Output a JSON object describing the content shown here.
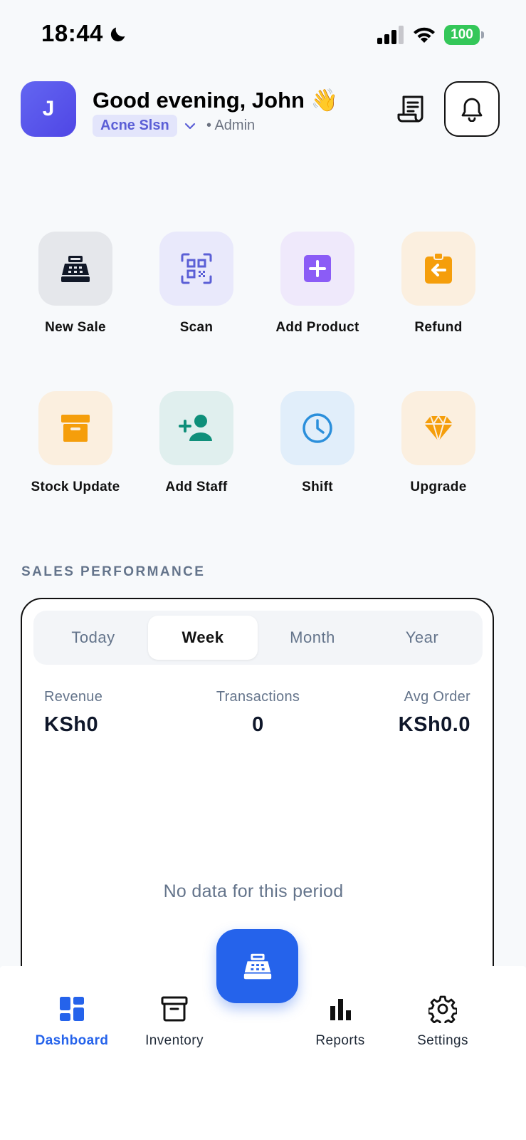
{
  "status_bar": {
    "time": "18:44",
    "battery": "100",
    "icons": [
      "moon-icon",
      "signal-icon",
      "wifi-icon",
      "battery-icon"
    ]
  },
  "header": {
    "avatar_initial": "J",
    "greeting": "Good evening, John 👋",
    "store": "Acne Slsn",
    "role": "• Admin",
    "icons": [
      "receipt-icon",
      "bell-icon",
      "chevron-down-icon"
    ]
  },
  "quick_actions": [
    {
      "label": "New Sale",
      "icon": "cash-register-icon",
      "color": "#111827",
      "bg": "#e5e7eb"
    },
    {
      "label": "Scan",
      "icon": "qr-scan-icon",
      "color": "#5b5fd6",
      "bg": "#e9e9fb"
    },
    {
      "label": "Add Product",
      "icon": "add-box-icon",
      "color": "#8b5cf6",
      "bg": "#efe9fb"
    },
    {
      "label": "Refund",
      "icon": "refund-icon",
      "color": "#f59e0b",
      "bg": "#fbefdf"
    },
    {
      "label": "Stock Update",
      "icon": "archive-box-icon",
      "color": "#f59e0b",
      "bg": "#fbefdf"
    },
    {
      "label": "Add Staff",
      "icon": "add-user-icon",
      "color": "#0f8f7a",
      "bg": "#e0efee"
    },
    {
      "label": "Shift",
      "icon": "clock-icon",
      "color": "#2b8fdb",
      "bg": "#e1eefa"
    },
    {
      "label": "Upgrade",
      "icon": "diamond-icon",
      "color": "#f59e0b",
      "bg": "#fbefdf"
    }
  ],
  "sales_performance": {
    "title": "SALES PERFORMANCE",
    "periods": [
      "Today",
      "Week",
      "Month",
      "Year"
    ],
    "active_period": "Week",
    "metrics": [
      {
        "label": "Revenue",
        "value": "KSh0"
      },
      {
        "label": "Transactions",
        "value": "0"
      },
      {
        "label": "Avg Order",
        "value": "KSh0.0"
      }
    ],
    "empty_message": "No data for this period"
  },
  "tabbar": {
    "items": [
      {
        "label": "Dashboard",
        "icon": "dashboard-icon",
        "active": true
      },
      {
        "label": "Inventory",
        "icon": "inventory-icon",
        "active": false
      },
      {
        "label": "Reports",
        "icon": "bar-chart-icon",
        "active": false
      },
      {
        "label": "Settings",
        "icon": "gear-icon",
        "active": false
      }
    ],
    "fab_icon": "cash-register-icon"
  },
  "colors": {
    "accent": "#2563eb",
    "avatar": "#5b5fd6",
    "battery": "#34c759"
  }
}
